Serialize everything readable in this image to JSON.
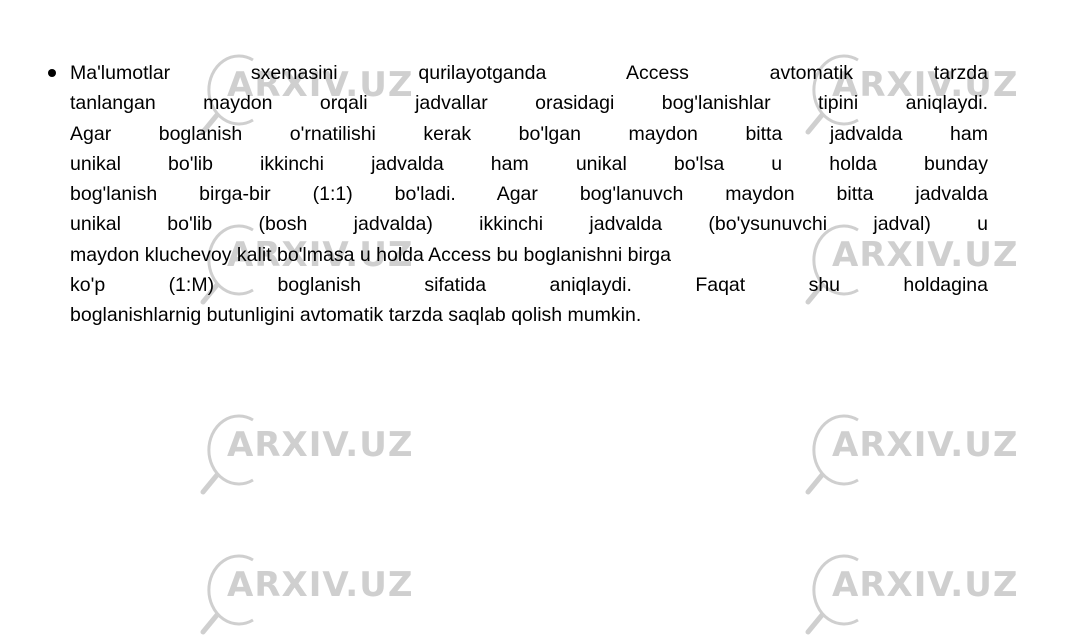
{
  "slide": {
    "bullet_paragraph": {
      "lines": [
        "Ma'lumotlar sxemasini qurilayotganda Access avtomatik tarzda",
        "tanlangan maydon orqali jadvallar orasidagi bog'lanishlar tipini aniqlaydi.",
        "Agar boglanish o'rnatilishi kerak bo'lgan maydon bitta jadvalda ham",
        "unikal bo'lib ikkinchi jadvalda ham unikal bo'lsa u holda bunday",
        "bog'lanish birga-bir (1:1) bo'ladi. Agar bog'lanuvch maydon bitta jadvalda",
        "unikal bo'lib (bosh jadvalda) ikkinchi jadvalda (bo'ysunuvchi jadval) u",
        "maydon kluchevoy kalit bo'lmasa u holda Access bu boglanishni birga",
        "ko'p (1:M) boglanish sifatida aniqlaydi. Faqat shu holdagina",
        "boglanishlarnig butunligini avtomatik tarzda saqlab qolish mumkin."
      ]
    }
  },
  "watermark": {
    "text": "ARXIV.UZ",
    "icon": "magnifier-icon",
    "color": "#cfcfcf"
  }
}
